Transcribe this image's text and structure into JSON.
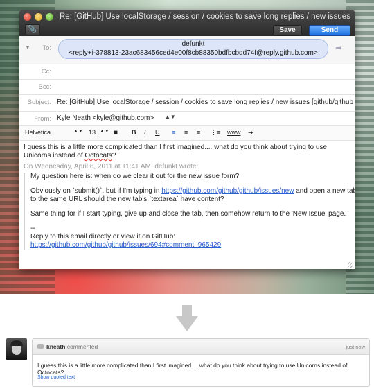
{
  "window": {
    "title": "Re: [GitHub] Use localStorage / session / cookies to save long replies / new issues [github/gi..."
  },
  "toolbar": {
    "attach_icon": "paperclip-icon",
    "save_label": "Save",
    "send_label": "Send"
  },
  "header": {
    "to_label": "To:",
    "to_name": "defunkt",
    "to_address": "<reply+i-378813-23ac683456ced4e00f8cb88350bdfbcbdd74f@reply.github.com>",
    "cc_label": "Cc:",
    "bcc_label": "Bcc:",
    "subject_label": "Subject:",
    "subject_value": "Re: [GitHub] Use localStorage / session / cookies to save long replies / new issues [github/github",
    "from_label": "From:",
    "from_value": "Kyle Neath <kyle@github.com>"
  },
  "format_bar": {
    "font": "Helvetica",
    "size": "13",
    "bold": "B",
    "italic": "I",
    "underline": "U",
    "list": "www"
  },
  "message": {
    "line1_a": "I guess this is a little more complicated than I first imagined.... what do you think about trying to use Unicorns",
    "line1_b": "instead of ",
    "line1_c": "Octocats",
    "line1_d": "?",
    "on_line": "On Wednesday, April 6, 2011 at 11:41 AM, defunkt wrote:",
    "q1": "My question here is: when do we clear it out for the new issue form?",
    "q2_a": "Obviously on `submit()`, but if I'm typing in ",
    "q2_link": "https://github.com/github/github/issues/new",
    "q2_b": " and open a new tab to the same URL should the new tab's `textarea` have content?",
    "q3": "Same thing for if I start typing, give up and close the tab, then somehow return to the 'New Issue' page.",
    "sig_dash": "--",
    "sig_text": "Reply to this email directly or view it on GitHub:",
    "sig_link": "https://github.com/github/github/issues/694#comment_965429"
  },
  "comment": {
    "author": "kneath",
    "verb": "commented",
    "time": "just now",
    "body": "I guess this is a little more complicated than I first imagined.... what do you think about trying to use Unicorns instead of Octocats?",
    "show_quoted": "Show quoted text"
  }
}
